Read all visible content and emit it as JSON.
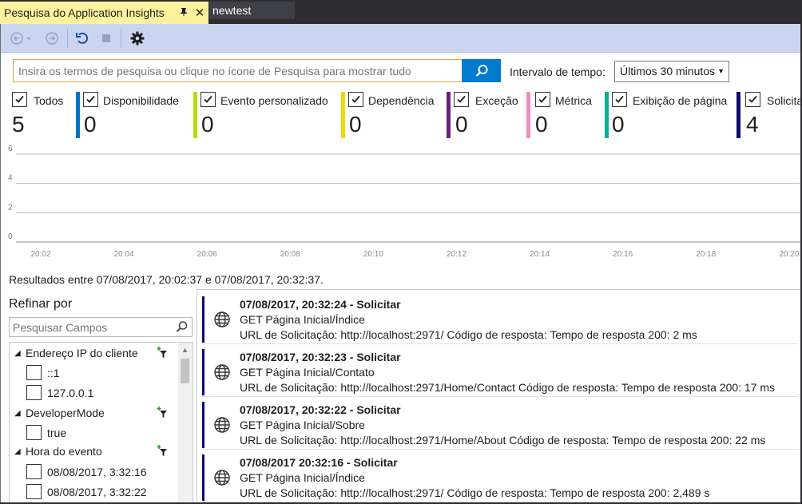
{
  "tabs": {
    "active": "Pesquisa do Application Insights",
    "pin_icon": "pin-icon",
    "close_icon": "close-icon",
    "inactive": "newtest"
  },
  "toolbar": {
    "back_icon": "back-arrow-icon",
    "forward_icon": "forward-arrow-icon",
    "refresh_icon": "refresh-icon",
    "stop_icon": "stop-icon",
    "settings_icon": "gear-icon"
  },
  "search": {
    "placeholder": "Insira os termos de pesquisa ou clique no ícone de Pesquisa para mostrar tudo",
    "value": "",
    "button_icon": "search-icon",
    "button_color": "#007acc"
  },
  "time_range": {
    "label": "Intervalo de tempo:",
    "selected": "Últimos 30 minutos"
  },
  "filters": [
    {
      "label": "Todos",
      "count": "5",
      "checked": true,
      "color": ""
    },
    {
      "label": "Disponibilidade",
      "count": "0",
      "checked": true,
      "color": "#0072c6"
    },
    {
      "label": "Evento personalizado",
      "count": "0",
      "checked": true,
      "color": "#bad80a"
    },
    {
      "label": "Dependência",
      "count": "0",
      "checked": true,
      "color": "#f2d600"
    },
    {
      "label": "Exceção",
      "count": "0",
      "checked": true,
      "color": "#68217a"
    },
    {
      "label": "Métrica",
      "count": "0",
      "checked": true,
      "color": "#f08cc0"
    },
    {
      "label": "Exibição de página",
      "count": "0",
      "checked": true,
      "color": "#00b294"
    },
    {
      "label": "Solicitação",
      "count": "4",
      "checked": true,
      "color": "#0a0a70"
    }
  ],
  "chart_data": {
    "type": "line",
    "y_ticks": [
      "6",
      "4",
      "2",
      "0"
    ],
    "ylim": [
      0,
      6
    ],
    "x_ticks": [
      "20:02",
      "20:04",
      "20:06",
      "20:08",
      "20:10",
      "20:12",
      "20:14",
      "20:16",
      "20:18",
      "20:20"
    ],
    "grid": true
  },
  "results_summary": "Resultados entre 07/08/2017, 20:02:37 e 07/08/2017, 20:32:37.",
  "refine": {
    "title": "Refinar por",
    "search_placeholder": "Pesquisar Campos",
    "groups": [
      {
        "name": "Endereço IP do cliente",
        "items": [
          "::1",
          "127.0.0.1"
        ]
      },
      {
        "name": "DeveloperMode",
        "items": [
          "true"
        ]
      },
      {
        "name": "Hora do evento",
        "items": [
          "08/08/2017, 3:32:16",
          "08/08/2017, 3:32:22"
        ]
      }
    ]
  },
  "results": [
    {
      "title": "07/08/2017, 20:32:24 - Solicitar",
      "line1": "GET Página Inicial/Índice",
      "line2": "URL de Solicitação: http://localhost:2971/ Código de resposta: Tempo de resposta 200: 2 ms"
    },
    {
      "title": "07/08/2017, 20:32:23 - Solicitar",
      "line1": "GET Página Inicial/Contato",
      "line2": "URL de Solicitação: http://localhost:2971/Home/Contact Código de resposta: Tempo de resposta 200: 17 ms"
    },
    {
      "title": "07/08/2017, 20:32:22 - Solicitar",
      "line1": "GET Página Inicial/Sobre",
      "line2": "URL de Solicitação: http://localhost:2971/Home/About Código de resposta: Tempo de resposta 200: 22 ms"
    },
    {
      "title": "07/08/2017 20:32:16 - Solicitar",
      "line1": "GET Página Inicial/Índice",
      "line2": "URL de Solicitação: http://localhost:2971/ Código de resposta: Tempo de resposta 200: 2,489 s"
    }
  ]
}
